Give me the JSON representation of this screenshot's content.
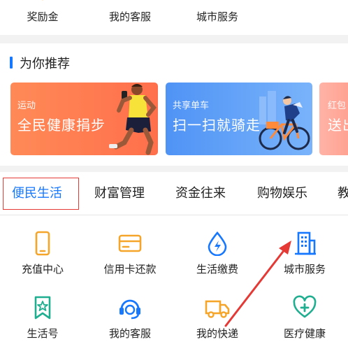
{
  "top_row": {
    "items": [
      {
        "label": "奖励金",
        "icon": "coin-icon"
      },
      {
        "label": "我的客服",
        "icon": "headset-icon"
      },
      {
        "label": "城市服务",
        "icon": "city-building-icon"
      }
    ]
  },
  "recommend": {
    "title": "为你推荐",
    "banners": [
      {
        "tag": "运动",
        "headline": "全民健康捐步",
        "illustration": "runner-illustration"
      },
      {
        "tag": "共享单车",
        "headline": "扫一扫就骑走",
        "illustration": "cyclist-illustration"
      },
      {
        "tag": "红包",
        "headline": "送出"
      }
    ]
  },
  "services": {
    "tabs": [
      {
        "label": "便民生活",
        "active": true
      },
      {
        "label": "财富管理",
        "active": false
      },
      {
        "label": "资金往来",
        "active": false
      },
      {
        "label": "购物娱乐",
        "active": false
      },
      {
        "label": "教",
        "active": false
      }
    ],
    "items": [
      {
        "label": "充值中心",
        "icon": "phone-icon"
      },
      {
        "label": "信用卡还款",
        "icon": "credit-card-icon"
      },
      {
        "label": "生活缴费",
        "icon": "water-drop-bolt-icon"
      },
      {
        "label": "城市服务",
        "icon": "city-building-icon"
      },
      {
        "label": "生活号",
        "icon": "bookmark-star-icon"
      },
      {
        "label": "我的客服",
        "icon": "headset-icon"
      },
      {
        "label": "我的快递",
        "icon": "delivery-truck-icon"
      },
      {
        "label": "医疗健康",
        "icon": "medical-cross-icon"
      }
    ]
  },
  "colors": {
    "accent": "#1677ff",
    "orange": "#f5a52a",
    "green": "#1fae8f",
    "annotation_red": "#e53935"
  }
}
